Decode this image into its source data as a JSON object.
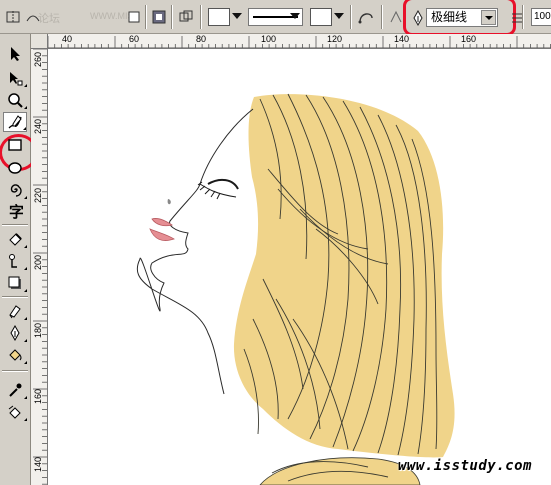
{
  "propbar": {
    "watermark_text": "论坛",
    "watermark_faint": "WWW.MISS",
    "outline_width_value": "极细线",
    "zoom_value": "100"
  },
  "ruler_top": {
    "labels": [
      "40",
      "60",
      "80",
      "100",
      "120",
      "140",
      "160"
    ]
  },
  "ruler_left": {
    "labels": [
      "260",
      "240",
      "220",
      "200",
      "180",
      "160",
      "140"
    ]
  },
  "toolbox": {
    "tools": [
      {
        "name": "pick-tool-icon"
      },
      {
        "name": "shape-tool-icon"
      },
      {
        "name": "zoom-tool-icon"
      },
      {
        "name": "freehand-tool-icon",
        "active": true
      },
      {
        "name": "rectangle-tool-icon"
      },
      {
        "name": "ellipse-tool-icon"
      },
      {
        "name": "spiral-tool-icon"
      },
      {
        "name": "text-tool-icon"
      },
      {
        "name": "interactive-fill-tool-icon"
      },
      {
        "name": "connector-tool-icon"
      },
      {
        "name": "shadow-tool-icon"
      },
      {
        "name": "envelope-tool-icon"
      },
      {
        "name": "outline-pen-tool-icon"
      },
      {
        "name": "fill-bucket-tool-icon"
      },
      {
        "name": "eyedropper-tool-icon"
      },
      {
        "name": "paint-bucket-tool-icon"
      }
    ]
  },
  "canvas": {
    "watermark": "www.isstudy.com"
  },
  "colors": {
    "hair_fill": "#f0d48a",
    "lips": "#e58e93",
    "annotation_red": "#e8102a"
  }
}
